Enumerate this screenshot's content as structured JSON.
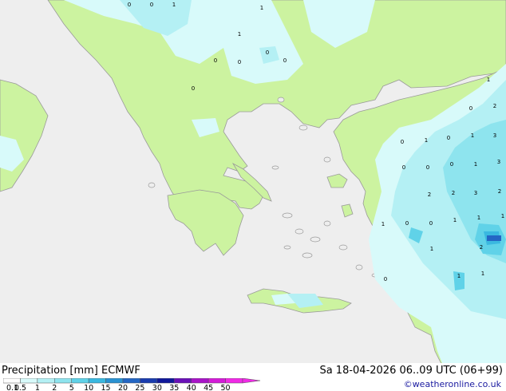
{
  "map": {
    "cell_labels": [
      {
        "text": "0"
      },
      {
        "text": "0"
      },
      {
        "text": "1"
      },
      {
        "text": "1"
      },
      {
        "text": "1"
      },
      {
        "text": "0"
      },
      {
        "text": "0"
      },
      {
        "text": "0"
      },
      {
        "text": "0"
      },
      {
        "text": "0"
      },
      {
        "text": "0"
      },
      {
        "text": "1"
      },
      {
        "text": "2"
      },
      {
        "text": "0"
      },
      {
        "text": "1"
      },
      {
        "text": "0"
      },
      {
        "text": "1"
      },
      {
        "text": "3"
      },
      {
        "text": "0"
      },
      {
        "text": "0"
      },
      {
        "text": "0"
      },
      {
        "text": "1"
      },
      {
        "text": "3"
      },
      {
        "text": "2"
      },
      {
        "text": "3"
      },
      {
        "text": "2"
      },
      {
        "text": "2"
      },
      {
        "text": "1"
      },
      {
        "text": "0"
      },
      {
        "text": "0"
      },
      {
        "text": "1"
      },
      {
        "text": "1"
      },
      {
        "text": "1"
      },
      {
        "text": "1"
      },
      {
        "text": "2"
      },
      {
        "text": "0"
      },
      {
        "text": "1"
      },
      {
        "text": "1"
      }
    ]
  },
  "footer": {
    "title": "Precipitation [mm]  ECMWF",
    "date": "Sa 18-04-2026 06..09 UTC (06+99)",
    "credit": "©weatheronline.co.uk"
  },
  "legend": {
    "labels": [
      "0.1",
      "0.5",
      "1",
      "2",
      "5",
      "10",
      "15",
      "20",
      "25",
      "30",
      "35",
      "40",
      "45",
      "50"
    ],
    "colors": [
      "#ffffff",
      "#d8fafa",
      "#b4f0f4",
      "#8ee4ee",
      "#60d2e8",
      "#3ab8e0",
      "#2a92d2",
      "#2466c4",
      "#1a3cae",
      "#10189a",
      "#6a10b8",
      "#a814c8",
      "#d41cd8",
      "#f02ae6"
    ]
  },
  "colors": {
    "sea": "#eeeeee",
    "land": "#ccf3a0",
    "border": "#9a9a9a"
  }
}
